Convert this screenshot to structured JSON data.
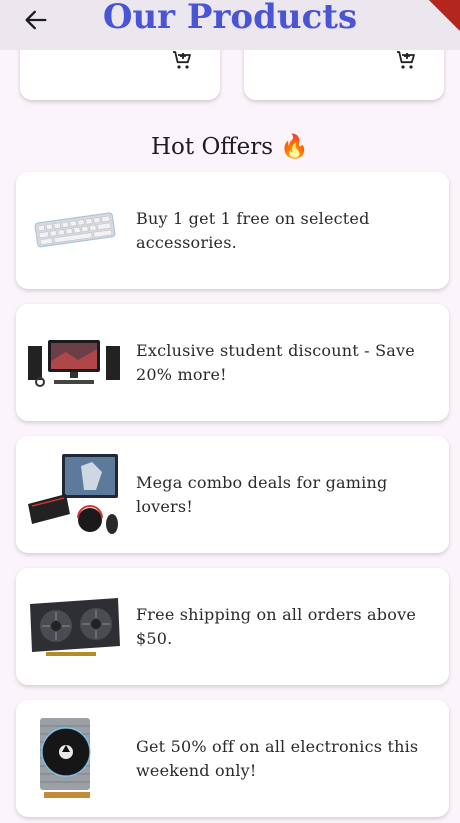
{
  "appbar": {
    "title": "Our Products"
  },
  "hot_offers": {
    "title": "Hot Offers 🔥",
    "items": [
      {
        "text": "Buy 1 get 1 free on selected accessories.",
        "image": "rgb-keyboard"
      },
      {
        "text": "Exclusive student discount - Save 20% more!",
        "image": "desktop-pc-setup"
      },
      {
        "text": "Mega combo deals for gaming lovers!",
        "image": "gaming-combo"
      },
      {
        "text": "Free shipping on all orders above $50.",
        "image": "graphics-card"
      },
      {
        "text": "Get 50% off on all electronics this weekend only!",
        "image": "cpu-cooler"
      }
    ]
  },
  "icons": {
    "back": "arrow-left-icon",
    "cart": "add-shopping-cart-icon"
  },
  "colors": {
    "title": "#4a55d6",
    "appbar": "#ece6ee",
    "background": "#fbf5fb",
    "card": "#ffffff"
  }
}
